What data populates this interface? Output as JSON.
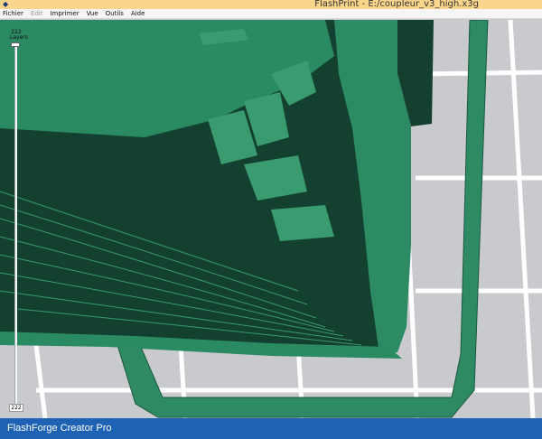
{
  "window": {
    "title": "FlashPrint - E:/coupleur_v3_high.x3g",
    "app_icon": "flashprint-app-icon"
  },
  "menu": {
    "items": [
      {
        "label": "Fichier",
        "enabled": true
      },
      {
        "label": "Edit",
        "enabled": false
      },
      {
        "label": "Imprimer",
        "enabled": true
      },
      {
        "label": "Vue",
        "enabled": true
      },
      {
        "label": "Outils",
        "enabled": true
      },
      {
        "label": "Aide",
        "enabled": true
      }
    ]
  },
  "layer_slider": {
    "current_value": "222",
    "current_label": "Layers",
    "bottom_value": "222"
  },
  "status": {
    "printer": "FlashForge Creator Pro"
  },
  "colors": {
    "model_dark": "#13402f",
    "model_light": "#2a8a62",
    "build_plate": "#c8cacd",
    "grid": "#ffffff",
    "status_bar": "#1e62b4",
    "title_bar": "#fad58c"
  }
}
